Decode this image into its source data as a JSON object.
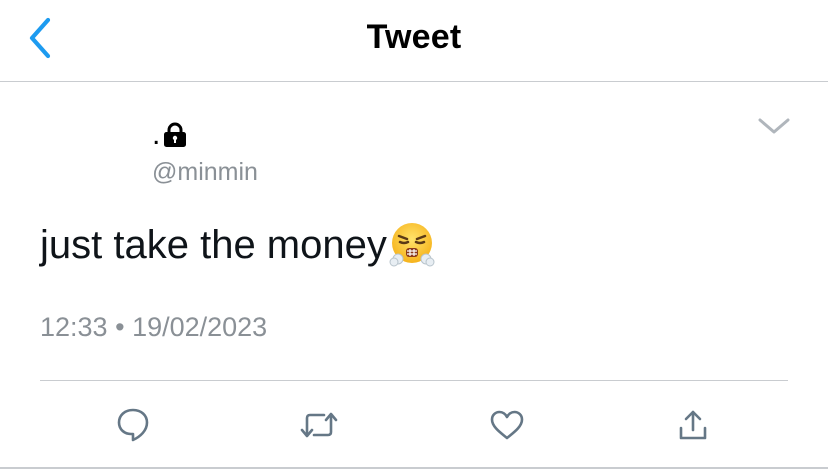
{
  "header": {
    "back_icon": "chevron-left-icon",
    "title": "Tweet"
  },
  "author": {
    "display_name": ".",
    "lock_icon": "lock-icon",
    "handle": "@minmin"
  },
  "menu": {
    "icon": "chevron-down-icon"
  },
  "tweet": {
    "text": "just take the money",
    "emoji": "face-with-steam-from-nose"
  },
  "meta": {
    "time": "12:33",
    "separator": "•",
    "date": "19/02/2023"
  },
  "actions": [
    {
      "icon": "reply-icon"
    },
    {
      "icon": "retweet-icon"
    },
    {
      "icon": "like-icon"
    },
    {
      "icon": "share-icon"
    }
  ],
  "colors": {
    "accent": "#1d9bf0",
    "icon_gray": "#657786",
    "secondary_text": "#8a9096",
    "divider": "#c9ccd0"
  }
}
